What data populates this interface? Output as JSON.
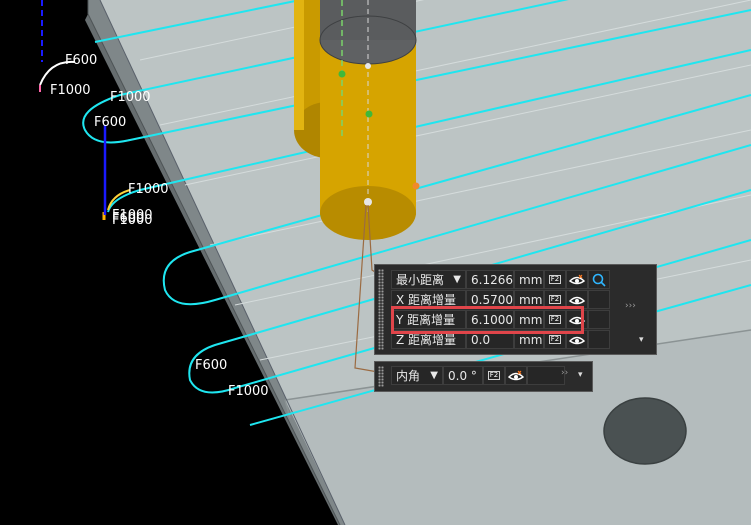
{
  "viewport": {
    "feed_labels": [
      "F600",
      "F1000",
      "F1000",
      "F600",
      "F1000",
      "F1000",
      "F1000",
      "F600",
      "F600",
      "F1000"
    ]
  },
  "measure_panel": {
    "rows": [
      {
        "label": "最小距离",
        "has_dropdown": true,
        "value": "6.1266",
        "unit": "mm"
      },
      {
        "label": "X 距离增量",
        "has_dropdown": false,
        "value": "0.5700",
        "unit": "mm"
      },
      {
        "label": "Y 距离增量",
        "has_dropdown": false,
        "value": "6.1000",
        "unit": "mm"
      },
      {
        "label": "Z 距离增量",
        "has_dropdown": false,
        "value": "0.0",
        "unit": "mm"
      }
    ],
    "f2_label": "F2",
    "icons": [
      "f2-icon",
      "visibility-eye-icon",
      "loop-icon",
      "panel-arrows-icon"
    ]
  },
  "angle_panel": {
    "label": "内角",
    "value": "0.0",
    "unit": "°",
    "f2_label": "F2"
  },
  "colors": {
    "toolpath": "#1fe6f0",
    "tool_body": "#d6a400",
    "tool_holder": "#606060",
    "part_top": "#bfc7c7",
    "part_side": "#8a9294",
    "highlight": "#e0454a",
    "axis_blue": "#1a1aff"
  }
}
